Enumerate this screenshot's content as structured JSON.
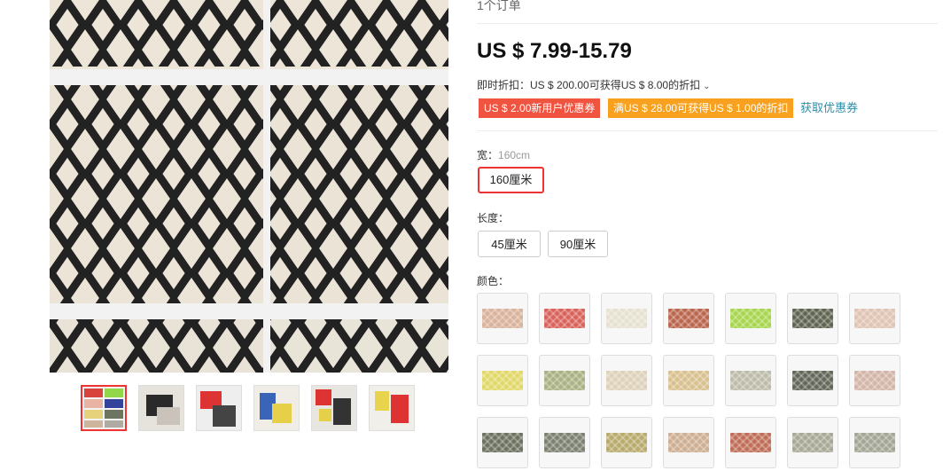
{
  "gallery": {
    "thumbnails": [
      {
        "name": "thumb-1-grid",
        "active": true
      },
      {
        "name": "thumb-2"
      },
      {
        "name": "thumb-3"
      },
      {
        "name": "thumb-4"
      },
      {
        "name": "thumb-5"
      },
      {
        "name": "thumb-6"
      }
    ],
    "panel_colors": {
      "top_left": "#d8443c",
      "top_right": "#93d64a",
      "mid_left": "#e9b3a3",
      "mid_right": "#34449c",
      "bottom_left": "#6d7462",
      "bottom_right": "#b0aba2"
    }
  },
  "product": {
    "orders": "1个订单",
    "price": "US $ 7.99-15.79",
    "instant_discount": "即时折扣：US $ 200.00可获得US $ 8.00的折扣",
    "coupon_new_user": "US $ 2.00新用户优惠券",
    "coupon_threshold": "满US $ 28.00可获得US $ 1.00的折扣",
    "coupon_link": "获取优惠券"
  },
  "width": {
    "label": "宽：",
    "selected_value": "160cm",
    "options": [
      "160厘米"
    ]
  },
  "length": {
    "label": "长度：",
    "options": [
      "45厘米",
      "90厘米"
    ]
  },
  "color": {
    "label": "颜色：",
    "swatches": [
      "#d9b29c",
      "#d8615a",
      "#e6e1cf",
      "#b9664c",
      "#a7d64e",
      "#5e6450",
      "#dfc3b3",
      "#e1d868",
      "#a9b182",
      "#ddd1b9",
      "#d8c08f",
      "#bdbcaa",
      "#63675a",
      "#d3b5a8",
      "#6c7260",
      "#7c8070",
      "#b8aa6c",
      "#ceae92",
      "#bf6d57",
      "#a8a896",
      "#a3a595"
    ]
  }
}
